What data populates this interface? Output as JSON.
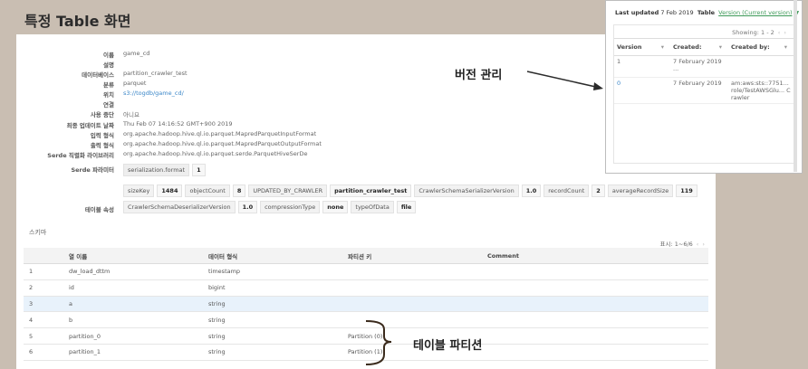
{
  "page_title": "특정 Table 화면",
  "properties": [
    {
      "label": "이름",
      "value": "game_cd"
    },
    {
      "label": "설명",
      "value": ""
    },
    {
      "label": "데이터베이스",
      "value": "partition_crawler_test"
    },
    {
      "label": "분류",
      "value": "parquet"
    },
    {
      "label": "위치",
      "value": "s3://togdb/game_cd/"
    },
    {
      "label": "연결",
      "value": ""
    },
    {
      "label": "사용 중단",
      "value": "아니요"
    },
    {
      "label": "최종 업데이트 날짜",
      "value": "Thu Feb 07 14:16:52 GMT+900 2019"
    },
    {
      "label": "입력 형식",
      "value": "org.apache.hadoop.hive.ql.io.parquet.MapredParquetInputFormat"
    },
    {
      "label": "출력 형식",
      "value": "org.apache.hadoop.hive.ql.io.parquet.MapredParquetOutputFormat"
    },
    {
      "label": "Serde 직렬화 라이브러리",
      "value": "org.apache.hadoop.hive.ql.io.parquet.serde.ParquetHiveSerDe"
    }
  ],
  "serde_params": {
    "label": "Serde 파라미터",
    "items": [
      "serialization.format",
      "1"
    ]
  },
  "table_props": {
    "label": "테이블 속성",
    "row1": [
      "sizeKey",
      "1484",
      "objectCount",
      "8",
      "UPDATED_BY_CRAWLER",
      "partition_crawler_test",
      "CrawlerSchemaSerializerVersion",
      "1.0",
      "recordCount",
      "2",
      "averageRecordSize",
      "119"
    ],
    "row2": [
      "CrawlerSchemaDeserializerVersion",
      "1.0",
      "compressionType",
      "none",
      "typeOfData",
      "file"
    ]
  },
  "schema": {
    "label": "스키마",
    "pager": "표시: 1~6/6",
    "headers": [
      "",
      "열 이름",
      "데이터 형식",
      "파티션 키",
      "Comment"
    ],
    "rows": [
      [
        "1",
        "dw_load_dttm",
        "timestamp",
        "",
        ""
      ],
      [
        "2",
        "id",
        "bigint",
        "",
        ""
      ],
      [
        "3",
        "a",
        "string",
        "",
        ""
      ],
      [
        "4",
        "b",
        "string",
        "",
        ""
      ],
      [
        "5",
        "partition_0",
        "string",
        "Partition (0)",
        ""
      ],
      [
        "6",
        "partition_1",
        "string",
        "Partition (1)",
        ""
      ]
    ]
  },
  "version_popup": {
    "last_updated_label": "Last updated",
    "last_updated_value": "7 Feb 2019",
    "table_label": "Table",
    "version_select": "Version (Current version)",
    "showing": "Showing: 1 - 2",
    "headers": [
      "Version",
      "Created:",
      "Created by:"
    ],
    "rows": [
      {
        "version": "1",
        "created": "7 February 2019 ...",
        "created_by": ""
      },
      {
        "version": "0",
        "created": "7 February 2019",
        "created_by": "am:aws:sts::7751... role/TestAWSGlu... Crawler"
      }
    ]
  },
  "annotations": {
    "version_mgmt": "버전 관리",
    "table_partition": "테이블 파티션"
  },
  "colors": {
    "background": "#c9beb2",
    "link": "#3a86c8",
    "version_link": "#3d9a58",
    "highlight_row": "#e8f2fb"
  }
}
